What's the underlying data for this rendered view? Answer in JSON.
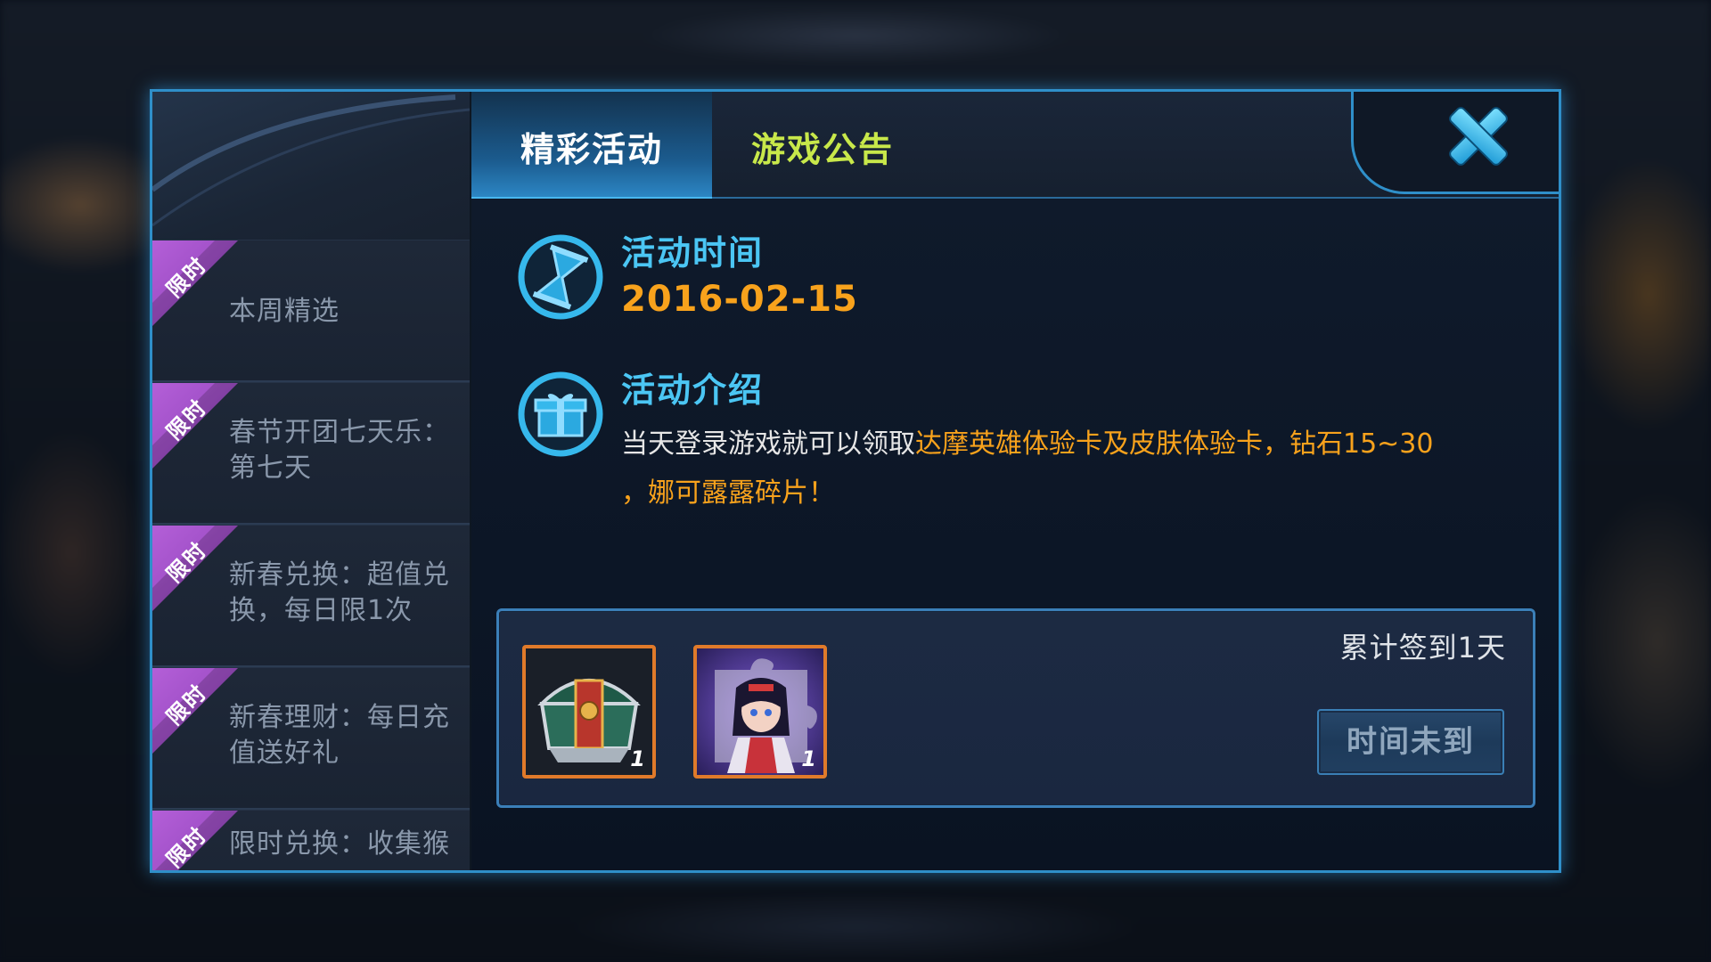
{
  "tabs": {
    "events_label": "精彩活动",
    "notice_label": "游戏公告"
  },
  "sidebar": {
    "items": [
      {
        "badge": "限时",
        "label": "本周精选"
      },
      {
        "badge": "限时",
        "label": "春节开团七天乐：第七天"
      },
      {
        "badge": "限时",
        "label": "新春兑换：超值兑换，每日限1次"
      },
      {
        "badge": "限时",
        "label": "新春理财：每日充值送好礼"
      },
      {
        "badge": "限时",
        "label": "限时兑换：收集猴"
      }
    ]
  },
  "event": {
    "time_title": "活动时间",
    "time_value": "2016-02-15",
    "intro_title": "活动介绍",
    "intro_prefix": "当天登录游戏就可以领取",
    "intro_highlight_1": "达摩英雄体验卡及皮肤体验卡，钻石15~30",
    "intro_highlight_2": "，娜可露露碎片！"
  },
  "reward": {
    "items": [
      {
        "icon": "treasure-chest-icon",
        "count": "1"
      },
      {
        "icon": "hero-fragment-nakoruru-icon",
        "count": "1"
      }
    ],
    "checkin_text": "累计签到1天",
    "button_label": "时间未到"
  },
  "colors": {
    "accent_blue": "#4bc6f4",
    "highlight_orange": "#f8a21c",
    "notice_tab_yellow": "#c8e84a",
    "badge_purple": "#9b4bc8",
    "border_blue": "#2f8fc9"
  }
}
